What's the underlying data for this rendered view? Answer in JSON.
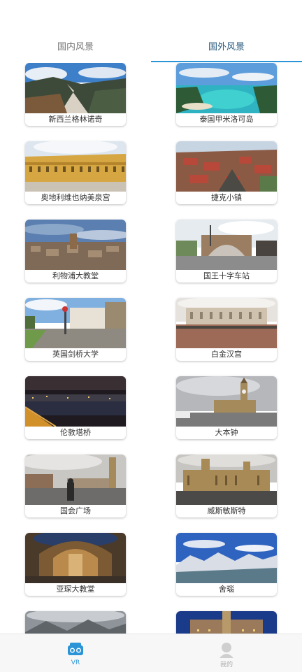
{
  "tabs": {
    "domestic": "国内风景",
    "foreign": "国外风景"
  },
  "cards": [
    "新西兰格林诺奇",
    "泰国甲米洛可岛",
    "奥地利维也纳美泉宫",
    "捷克小镇",
    "利物浦大教堂",
    "国王十字车站",
    "英国剑桥大学",
    "白金汉宫",
    "伦敦塔桥",
    "大本钟",
    "国会广场",
    "威斯敏斯特",
    "亚琛大教堂",
    "舍瑙",
    "",
    ""
  ],
  "bottom_nav": {
    "vr": "VR",
    "mine": "我的"
  }
}
